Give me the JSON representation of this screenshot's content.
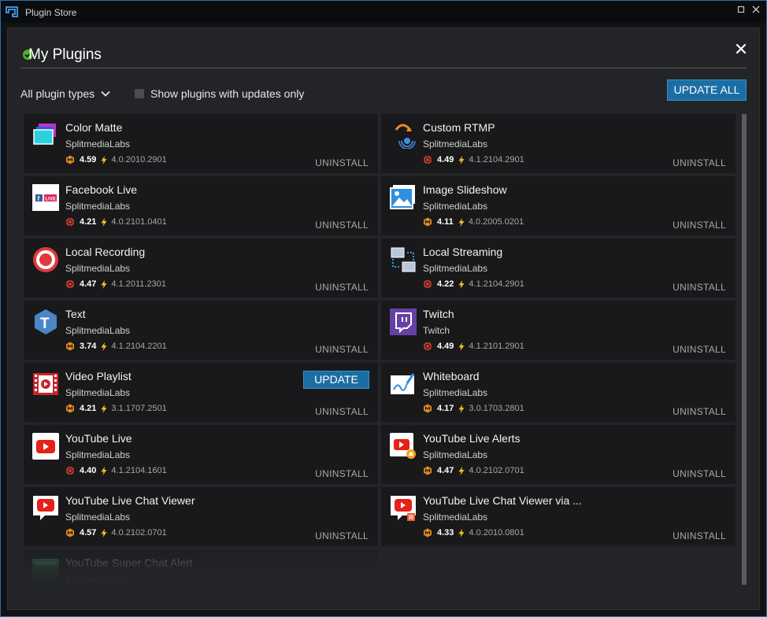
{
  "window": {
    "title": "Plugin Store",
    "maximize_glyph": "▫",
    "close_glyph": "✕"
  },
  "header": {
    "title": "My Plugins",
    "check_color": "#4db32c"
  },
  "toolbar": {
    "type_filter": "All plugin types",
    "updates_only_label": "Show plugins with updates only",
    "updates_only_checked": false,
    "update_all_label": "UPDATE ALL"
  },
  "colors": {
    "accent": "#1b6ea3",
    "bolt": "#f0c020",
    "badge_orange": "#e08a1e",
    "badge_red": "#d43a2f"
  },
  "plugins": [
    {
      "name": "Color Matte",
      "developer": "SplitmediaLabs",
      "rating": "4.59",
      "version": "4.0.2010.2901",
      "badge": "orange",
      "icon": "color-matte-icon",
      "action": "UNINSTALL"
    },
    {
      "name": "Custom RTMP",
      "developer": "SplitmediaLabs",
      "rating": "4.49",
      "version": "4.1.2104.2901",
      "badge": "red",
      "icon": "custom-rtmp-icon",
      "action": "UNINSTALL"
    },
    {
      "name": "Facebook Live",
      "developer": "SplitmediaLabs",
      "rating": "4.21",
      "version": "4.0.2101.0401",
      "badge": "red",
      "icon": "facebook-live-icon",
      "action": "UNINSTALL",
      "icon_text": "LIVE"
    },
    {
      "name": "Image Slideshow",
      "developer": "SplitmediaLabs",
      "rating": "4.11",
      "version": "4.0.2005.0201",
      "badge": "orange",
      "icon": "image-slideshow-icon",
      "action": "UNINSTALL"
    },
    {
      "name": "Local Recording",
      "developer": "SplitmediaLabs",
      "rating": "4.47",
      "version": "4.1.2011.2301",
      "badge": "red",
      "icon": "local-recording-icon",
      "action": "UNINSTALL"
    },
    {
      "name": "Local Streaming",
      "developer": "SplitmediaLabs",
      "rating": "4.22",
      "version": "4.1.2104.2901",
      "badge": "red",
      "icon": "local-streaming-icon",
      "action": "UNINSTALL"
    },
    {
      "name": "Text",
      "developer": "SplitmediaLabs",
      "rating": "3.74",
      "version": "4.1.2104.2201",
      "badge": "orange",
      "icon": "text-plugin-icon",
      "action": "UNINSTALL",
      "icon_text": "T"
    },
    {
      "name": "Twitch",
      "developer": "Twitch",
      "rating": "4.49",
      "version": "4.1.2101.2901",
      "badge": "red",
      "icon": "twitch-icon",
      "action": "UNINSTALL"
    },
    {
      "name": "Video Playlist",
      "developer": "SplitmediaLabs",
      "rating": "4.21",
      "version": "3.1.1707.2501",
      "badge": "orange",
      "icon": "video-playlist-icon",
      "action": "UNINSTALL",
      "update_label": "UPDATE"
    },
    {
      "name": "Whiteboard",
      "developer": "SplitmediaLabs",
      "rating": "4.17",
      "version": "3.0.1703.2801",
      "badge": "orange",
      "icon": "whiteboard-icon",
      "action": "UNINSTALL"
    },
    {
      "name": "YouTube Live",
      "developer": "SplitmediaLabs",
      "rating": "4.40",
      "version": "4.1.2104.1601",
      "badge": "red",
      "icon": "youtube-live-icon",
      "action": "UNINSTALL"
    },
    {
      "name": "YouTube Live Alerts",
      "developer": "SplitmediaLabs",
      "rating": "4.47",
      "version": "4.0.2102.0701",
      "badge": "orange",
      "icon": "youtube-live-alerts-icon",
      "action": "UNINSTALL"
    },
    {
      "name": "YouTube Live Chat Viewer",
      "developer": "SplitmediaLabs",
      "rating": "4.57",
      "version": "4.0.2102.0701",
      "badge": "orange",
      "icon": "youtube-chat-viewer-icon",
      "action": "UNINSTALL"
    },
    {
      "name": "YouTube Live Chat Viewer via ...",
      "developer": "SplitmediaLabs",
      "rating": "4.33",
      "version": "4.0.2010.0801",
      "badge": "orange",
      "icon": "youtube-chat-viewer-via-icon",
      "action": "UNINSTALL"
    },
    {
      "name": "YouTube Super Chat Alert",
      "developer": "SplitmediaLabs",
      "rating": "",
      "version": "",
      "badge": "none",
      "icon": "youtube-super-chat-icon",
      "action": ""
    }
  ]
}
